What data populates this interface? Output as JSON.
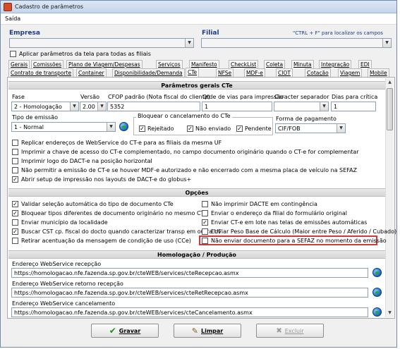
{
  "window": {
    "title": "Cadastro de parâmetros"
  },
  "menu": {
    "saida": "Saída"
  },
  "header": {
    "empresa_label": "Empresa",
    "filial_label": "Filial",
    "hint": "\"CTRL + F\" para localizar os campos",
    "apply_all_label": "Aplicar parâmetros da tela para todas as filiais"
  },
  "tabs_row1": [
    "Gerais",
    "Comissões",
    "Plano de Viagem/Despesas",
    "Serviços",
    "Manifesto",
    "CheckList",
    "Coleta",
    "Minuta",
    "Integração",
    "EDI"
  ],
  "tabs_row2": [
    "Contrato de transporte",
    "Container",
    "Disponibilidade/Demanda",
    "CTe",
    "NFSe",
    "MDF-e",
    "CIOT",
    "Cotação",
    "Viagem",
    "Mobile"
  ],
  "cte_section": {
    "title": "Parâmetros gerais CTe",
    "fase_label": "Fase",
    "fase_value": "2 - Homologação",
    "versao_label": "Versão",
    "versao_value": "2.00",
    "cfop_label": "CFOP padrão (Nota fiscal do cliente)",
    "cfop_value": "5352",
    "qtde_label": "Qtde de vias para impressão",
    "qtde_value": "1",
    "caracter_label": "Caracter separador",
    "caracter_value": "",
    "dias_label": "Dias para crítica",
    "dias_value": "1",
    "tipo_emissao_label": "Tipo de emissão",
    "tipo_emissao_value": "1 - Normal",
    "bloquear_label": "Bloquear o cancelamento do CTe",
    "rejeitado_label": "Rejeitado",
    "nao_enviado_label": "Não enviado",
    "pendente_label": "Pendente",
    "forma_pgto_label": "Forma de pagamento",
    "forma_pgto_value": "CIF/FOB",
    "options": [
      "Replicar endereços de WebService do CT-e para as filiais da mesma UF",
      "Imprimir a chave de acesso do CT-e complementado, no campo documento originário quando o CT-e for complementar",
      "Imprimir logo do DACT-e na posição horizontal",
      "Não permitir a emissão de CT-e se houver MDF-e autorizado e não encerrado com a mesma placa de veículo na SEFAZ",
      "Abrir setup de impressão nos layouts de DACT-e do globus+"
    ],
    "options_checked": [
      false,
      false,
      false,
      false,
      true
    ]
  },
  "opcoes": {
    "title": "Opções",
    "left": [
      "Validar seleção automática do tipo de documento CTe",
      "Bloquear tipos diferentes de documento originário no mesmo CTe",
      "Enviar município da localidade",
      "Buscar CST cp. fiscal do docto quando caracterizar transp em outra UF",
      "Retirar acentuação da mensagem de condição de uso (CCe)"
    ],
    "left_checked": [
      true,
      true,
      false,
      true,
      false
    ],
    "right": [
      "Não imprimir DACTE em contingência",
      "Enviar o endereço da filial do formulário original",
      "Enviar CT-e em lote nas telas de emissões automáticas",
      "Enviar Peso Base de Cálculo (Maior entre Peso / Aferido / Cubado)",
      "Não enviar documento para a SEFAZ no momento da emissão"
    ],
    "right_checked": [
      false,
      false,
      true,
      false,
      false
    ]
  },
  "homolog": {
    "title": "Homologação / Produção",
    "recepcao_label": "Endereço WebService recepção",
    "recepcao_value": "https://homologacao.nfe.fazenda.sp.gov.br/cteWEB/services/cteRecepcao.asmx",
    "retorno_label": "Endereço WebService retorno recepção",
    "retorno_value": "https://homologacao.nfe.fazenda.sp.gov.br/cteWEB/services/cteRetRecepcao.asmx",
    "cancel_label": "Endereço WebService cancelamento",
    "cancel_value": "https://homologacao.nfe.fazenda.sp.gov.br/cteWEB/services/cteCancelamento.asmx"
  },
  "buttons": {
    "gravar": "Gravar",
    "limpar": "Limpar",
    "excluir": "Excluir"
  },
  "colors": {
    "highlight": "#d23a3a",
    "section_blue": "#1a3a8c"
  }
}
